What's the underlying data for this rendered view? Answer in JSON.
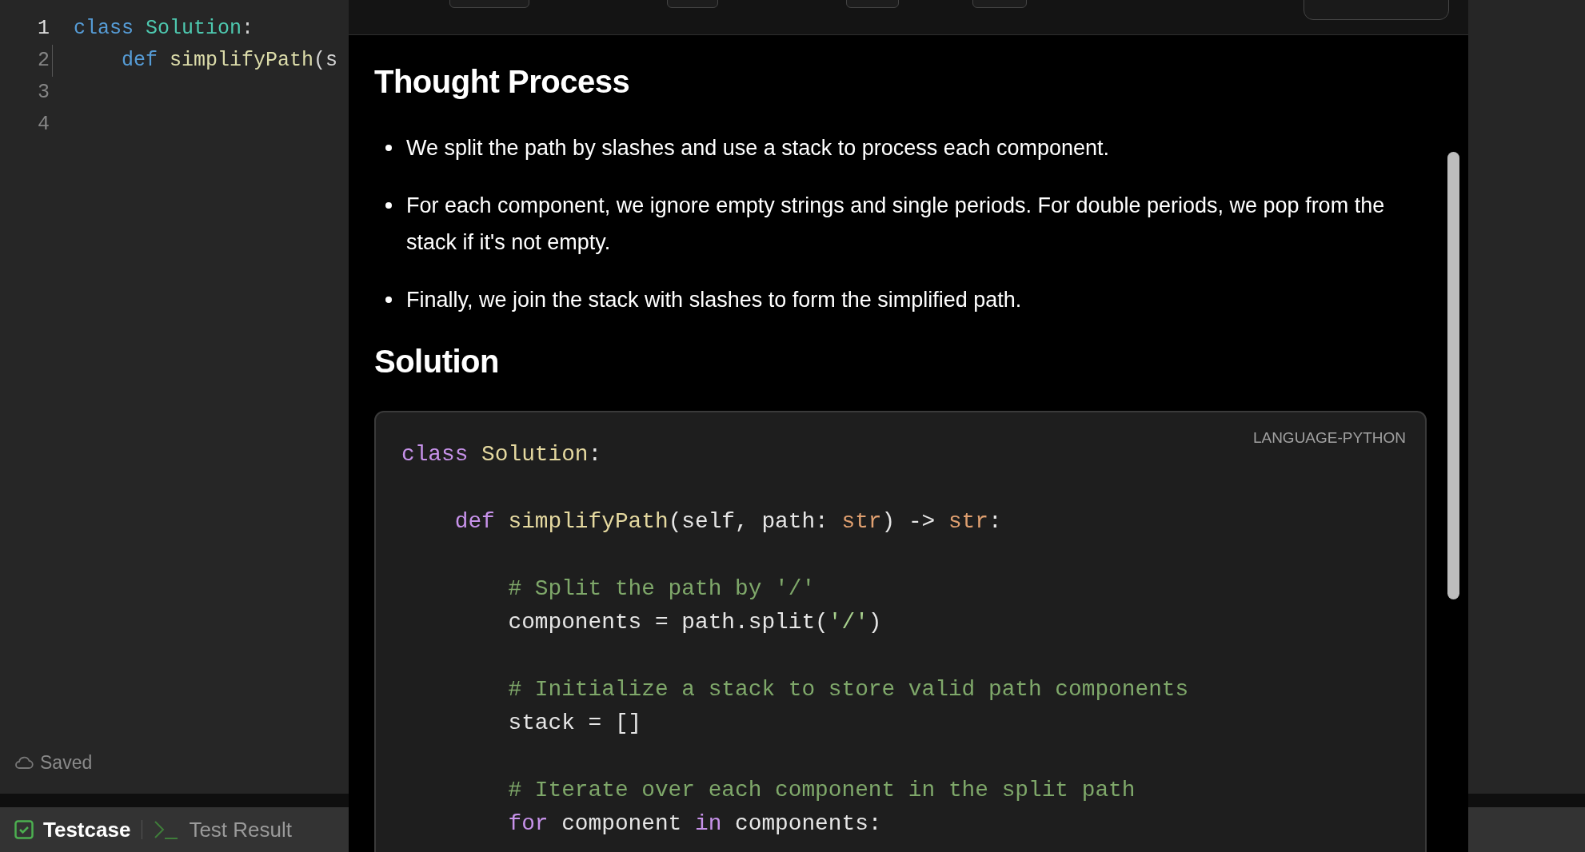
{
  "editor": {
    "lines": [
      {
        "number": "1",
        "active": true,
        "tokens": [
          {
            "text": "class ",
            "kind": "keyword"
          },
          {
            "text": "Solution",
            "kind": "type"
          },
          {
            "text": ":",
            "kind": "plain"
          }
        ]
      },
      {
        "number": "2",
        "active": false,
        "tokens": [
          {
            "text": "    def ",
            "kind": "keyword"
          },
          {
            "text": "simplifyPath",
            "kind": "function"
          },
          {
            "text": "(s",
            "kind": "plain"
          }
        ]
      },
      {
        "number": "3",
        "active": false
      },
      {
        "number": "4",
        "active": false
      }
    ],
    "status": "Saved"
  },
  "bottom_tabs": [
    {
      "label": "Testcase",
      "selected": true,
      "kind": "check"
    },
    {
      "label": "Test Result",
      "selected": false,
      "kind": "terminal"
    }
  ],
  "overlay": {
    "sections": [
      {
        "kind": "bullets",
        "heading": "Thought Process",
        "items": [
          "We split the path by slashes and use a stack to process each component.",
          "For each component, we ignore empty strings and single periods. For double periods, we pop from the stack if it's not empty.",
          "Finally, we join the stack with slashes to form the simplified path."
        ]
      },
      {
        "kind": "code",
        "heading": "Solution",
        "language": "LANGUAGE-PYTHON",
        "lines": [
          {
            "blank_before": false,
            "tokens": [
              {
                "text": "class ",
                "kind": "keyword"
              },
              {
                "text": "Solution",
                "kind": "type"
              },
              {
                "text": ":",
                "kind": "plain"
              }
            ]
          },
          {
            "blank_before": true,
            "tokens": [
              {
                "text": "    def ",
                "kind": "keyword"
              },
              {
                "text": "simplifyPath",
                "kind": "function"
              },
              {
                "text": "(self, path: ",
                "kind": "plain"
              },
              {
                "text": "str",
                "kind": "builtin"
              },
              {
                "text": ") -> ",
                "kind": "plain"
              },
              {
                "text": "str",
                "kind": "builtin"
              },
              {
                "text": ":",
                "kind": "plain"
              }
            ]
          },
          {
            "blank_before": true,
            "tokens": [
              {
                "text": "        # Split the path by '/'",
                "kind": "comment"
              }
            ]
          },
          {
            "blank_before": false,
            "tokens": [
              {
                "text": "        components = path.split(",
                "kind": "plain"
              },
              {
                "text": "'/'",
                "kind": "string"
              },
              {
                "text": ")",
                "kind": "plain"
              }
            ]
          },
          {
            "blank_before": true,
            "tokens": [
              {
                "text": "        # Initialize a stack to store valid path components",
                "kind": "comment"
              }
            ]
          },
          {
            "blank_before": false,
            "tokens": [
              {
                "text": "        stack = []",
                "kind": "plain"
              }
            ]
          },
          {
            "blank_before": true,
            "tokens": [
              {
                "text": "        # Iterate over each component in the split path",
                "kind": "comment"
              }
            ]
          },
          {
            "blank_before": false,
            "tokens": [
              {
                "text": "        for ",
                "kind": "keyword"
              },
              {
                "text": "component ",
                "kind": "plain"
              },
              {
                "text": "in ",
                "kind": "keyword"
              },
              {
                "text": "components:",
                "kind": "plain"
              }
            ]
          }
        ]
      }
    ]
  }
}
